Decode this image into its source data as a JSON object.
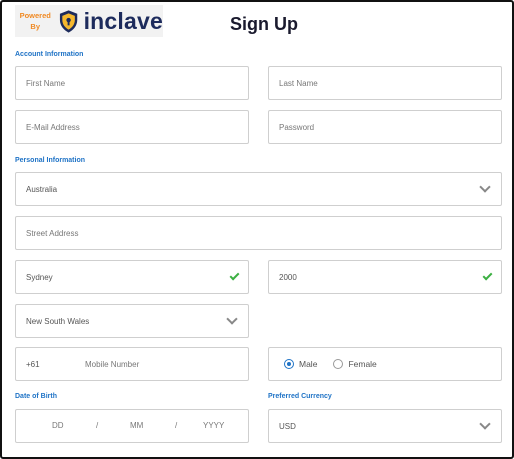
{
  "brand": {
    "powered_line1": "Powered",
    "powered_line2": "By",
    "name": "inclave"
  },
  "page": {
    "title": "Sign Up"
  },
  "sections": {
    "account": "Account Information",
    "personal": "Personal Information",
    "dob": "Date of Birth",
    "currency": "Preferred Currency"
  },
  "fields": {
    "first_name": {
      "placeholder": "First Name"
    },
    "last_name": {
      "placeholder": "Last Name"
    },
    "email": {
      "placeholder": "E-Mail Address"
    },
    "password": {
      "placeholder": "Password"
    },
    "country": {
      "value": "Australia"
    },
    "street": {
      "placeholder": "Street Address"
    },
    "city": {
      "value": "Sydney"
    },
    "postcode": {
      "value": "2000"
    },
    "state": {
      "value": "New South Wales"
    },
    "phone_code": {
      "value": "+61"
    },
    "mobile": {
      "placeholder": "Mobile Number"
    },
    "gender": {
      "options": [
        "Male",
        "Female"
      ],
      "selected": "Male"
    },
    "dob": {
      "day": "DD",
      "month": "MM",
      "year": "YYYY",
      "separator": "/"
    },
    "currency": {
      "value": "USD"
    }
  },
  "icons": {
    "brand": "shield-lock-icon",
    "dropdown": "chevron-down-icon",
    "valid": "check-icon"
  },
  "colors": {
    "accent": "#1f73c6",
    "brand_orange": "#f08a24",
    "brand_navy": "#1d2b5c",
    "valid": "#3cb043"
  }
}
